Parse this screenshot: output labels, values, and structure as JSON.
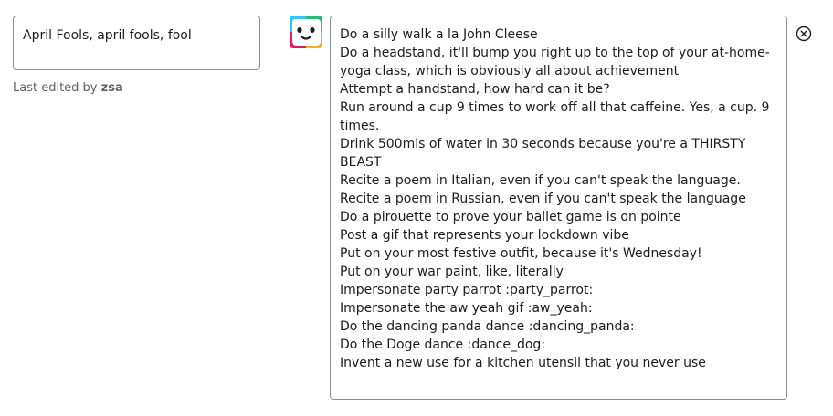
{
  "trigger": {
    "value": "April Fools, april fools, fool"
  },
  "meta": {
    "last_edited_prefix": "Last edited by",
    "last_edited_user": "zsa"
  },
  "response": {
    "lines": [
      "Do a silly walk a la John Cleese",
      "Do a headstand, it'll bump you right up to the top of your at-home-yoga class, which is obviously all about achievement",
      "Attempt a handstand, how hard can it be?",
      "Run around a cup 9 times to work off all that caffeine. Yes, a cup. 9 times.",
      "Drink 500mls of water in 30 seconds because you're a THIRSTY BEAST",
      "Recite a poem in Italian, even if you can't speak the language.",
      "Recite a poem in Russian, even if you can't speak the language",
      "Do a pirouette to prove your ballet game is on pointe",
      "Post a gif that represents your lockdown vibe",
      "Put on your most festive outfit, because it's Wednesday!",
      "Put on your war paint, like, literally",
      "Impersonate party parrot :party_parrot:",
      "Impersonate the aw yeah gif :aw_yeah:",
      "Do the dancing panda dance :dancing_panda:",
      "Do the Doge dance :dance_dog:",
      "Invent a new use for a kitchen utensil that you never use"
    ]
  },
  "icons": {
    "avatar": "slackbot-avatar-icon",
    "close": "close-circle-icon"
  },
  "colors": {
    "border": "#8d8d8f",
    "text": "#1d1c1d",
    "muted": "#616061",
    "avatar_green": "#2eb67d",
    "avatar_blue": "#36c5f0",
    "avatar_red": "#e01e5a",
    "avatar_yellow": "#ecb22e"
  }
}
